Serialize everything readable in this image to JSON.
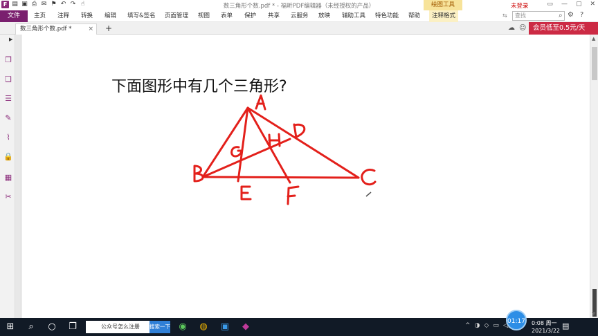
{
  "window": {
    "title": "数三角形个数.pdf * - 福昕PDF编辑器（未经授权的产品）",
    "drawing_tools_tab": "绘图工具",
    "login_label": "未登录"
  },
  "menu": {
    "file": "文件",
    "items": [
      "主页",
      "注释",
      "转换",
      "编辑",
      "填写&签名",
      "页面管理",
      "视图",
      "表单",
      "保护",
      "共享",
      "云服务",
      "放映",
      "辅助工具",
      "特色功能",
      "帮助"
    ],
    "active": "注释格式",
    "search_placeholder": "查找"
  },
  "tabs": {
    "document": "数三角形个数.pdf *",
    "add": "+",
    "close": "×"
  },
  "promo": {
    "vip_text": "会员低至0.5元/天"
  },
  "document": {
    "question": "下面图形中有几个三角形?",
    "labels": [
      "A",
      "B",
      "C",
      "D",
      "E",
      "F",
      "G",
      "H"
    ],
    "ink_color": "#e3201b"
  },
  "taskbar": {
    "search_text": "公众号怎么注册",
    "search_button": "搜索一下",
    "timer": "01:17",
    "time": "0:08 周一",
    "date": "2021/3/22"
  }
}
